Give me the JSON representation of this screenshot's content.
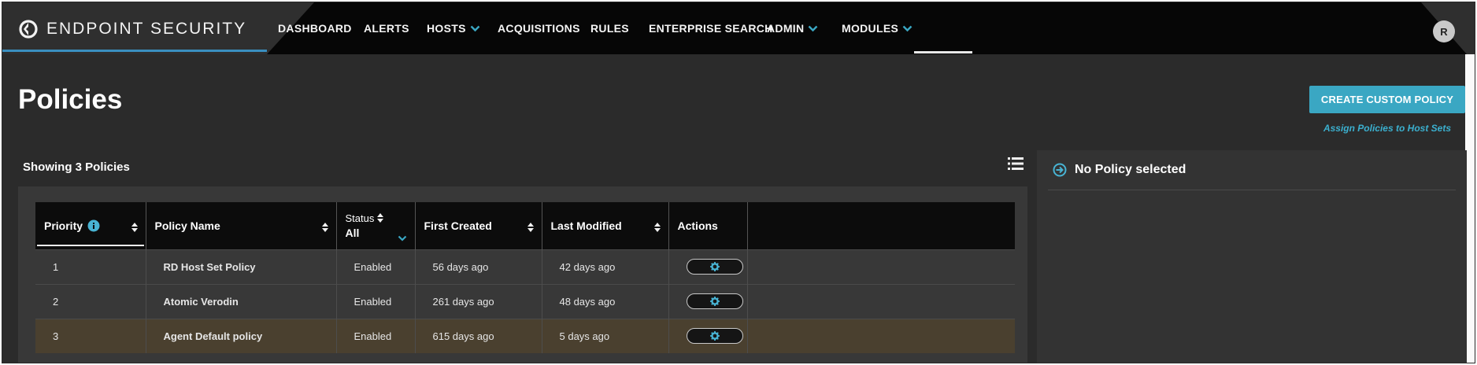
{
  "app": {
    "brand": "ENDPOINT SECURITY",
    "avatar_initial": "R"
  },
  "nav": {
    "items": [
      {
        "label": "DASHBOARD",
        "has_dropdown": false
      },
      {
        "label": "ALERTS",
        "has_dropdown": false
      },
      {
        "label": "HOSTS",
        "has_dropdown": true
      },
      {
        "label": "ACQUISITIONS",
        "has_dropdown": false
      },
      {
        "label": "RULES",
        "has_dropdown": false
      },
      {
        "label": "ENTERPRISE SEARCH",
        "has_dropdown": false
      },
      {
        "label": "ADMIN",
        "has_dropdown": true,
        "active": true
      },
      {
        "label": "MODULES",
        "has_dropdown": true
      }
    ]
  },
  "page": {
    "title": "Policies",
    "create_button": "CREATE CUSTOM POLICY",
    "assign_link": "Assign Policies to Host Sets",
    "showing": "Showing 3 Policies"
  },
  "table": {
    "columns": {
      "priority": "Priority",
      "policy_name": "Policy Name",
      "status": "Status",
      "status_filter": "All",
      "first_created": "First Created",
      "last_modified": "Last Modified",
      "actions": "Actions"
    },
    "rows": [
      {
        "priority": "1",
        "name": "RD Host Set Policy",
        "status": "Enabled",
        "first_created": "56 days ago",
        "last_modified": "42 days ago",
        "selected": false
      },
      {
        "priority": "2",
        "name": "Atomic Verodin",
        "status": "Enabled",
        "first_created": "261 days ago",
        "last_modified": "48 days ago",
        "selected": false
      },
      {
        "priority": "3",
        "name": "Agent Default policy",
        "status": "Enabled",
        "first_created": "615 days ago",
        "last_modified": "5 days ago",
        "selected": true
      }
    ]
  },
  "detail": {
    "heading": "No Policy selected"
  },
  "colors": {
    "accent": "#3aa7c3",
    "link": "#48b3d3",
    "selected_row": "#4a402f",
    "nav_bg": "#060606"
  },
  "icons": {
    "brand": "endpoint-logo-icon",
    "dropdown": "chevron-down-icon",
    "info": "info-icon",
    "sort": "sort-icon",
    "list_view": "list-view-icon",
    "gear": "gear-icon",
    "arrow": "arrow-circle-right-icon"
  }
}
